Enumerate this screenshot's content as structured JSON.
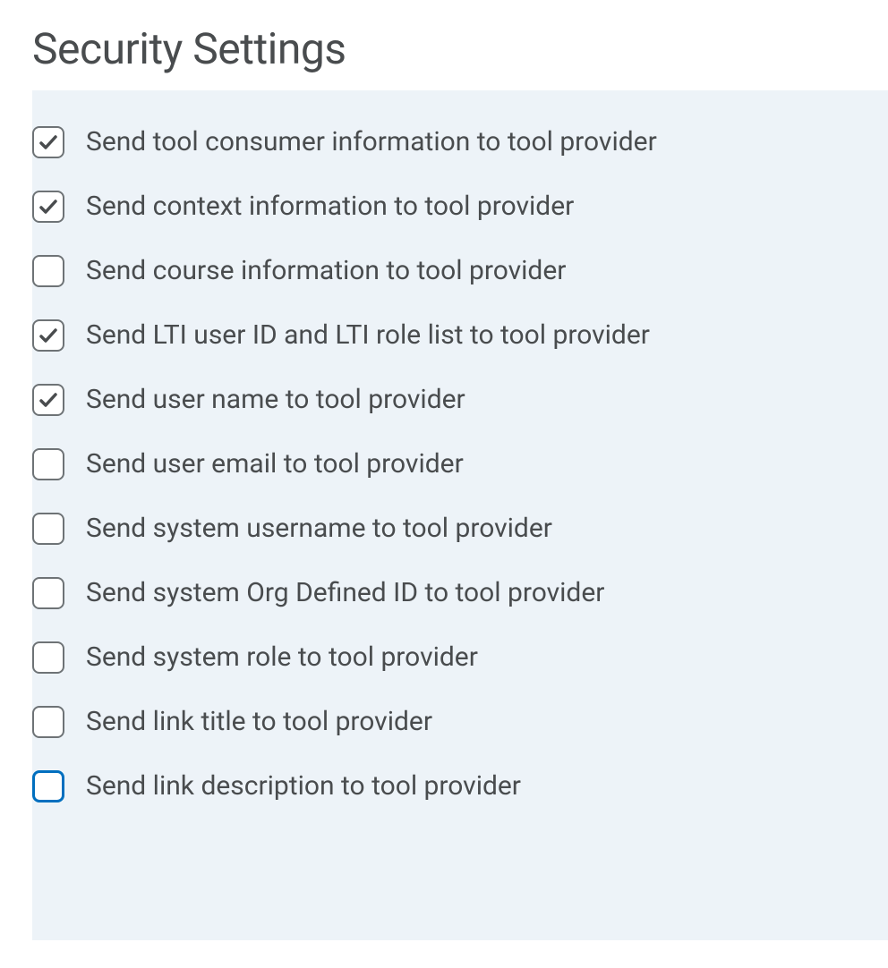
{
  "title": "Security Settings",
  "items": [
    {
      "label": "Send tool consumer information to tool provider",
      "checked": true,
      "focused": false
    },
    {
      "label": "Send context information to tool provider",
      "checked": true,
      "focused": false
    },
    {
      "label": "Send course information to tool provider",
      "checked": false,
      "focused": false
    },
    {
      "label": "Send LTI user ID and LTI role list to tool provider",
      "checked": true,
      "focused": false
    },
    {
      "label": "Send user name to tool provider",
      "checked": true,
      "focused": false
    },
    {
      "label": "Send user email to tool provider",
      "checked": false,
      "focused": false
    },
    {
      "label": "Send system username to tool provider",
      "checked": false,
      "focused": false
    },
    {
      "label": "Send system Org Defined ID to tool provider",
      "checked": false,
      "focused": false
    },
    {
      "label": "Send system role to tool provider",
      "checked": false,
      "focused": false
    },
    {
      "label": "Send link title to tool provider",
      "checked": false,
      "focused": false
    },
    {
      "label": "Send link description to tool provider",
      "checked": false,
      "focused": true
    }
  ]
}
